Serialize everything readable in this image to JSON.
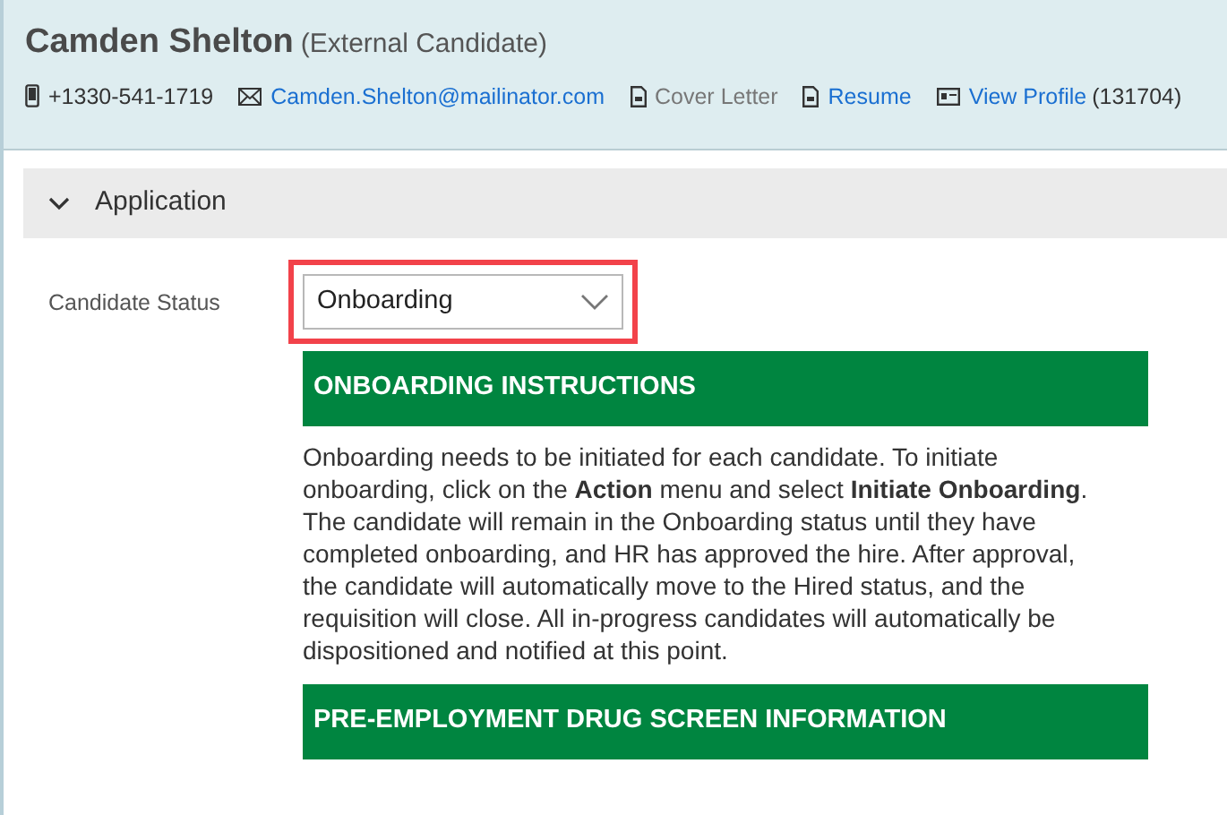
{
  "candidate": {
    "name": "Camden Shelton",
    "type": "(External Candidate)"
  },
  "contacts": [
    {
      "kind": "phone",
      "label": "+1330-541-1719",
      "link": false,
      "disabled": false
    },
    {
      "kind": "email",
      "label": "Camden.Shelton@mailinator.com",
      "link": true,
      "disabled": false
    },
    {
      "kind": "document",
      "label": "Cover Letter",
      "link": false,
      "disabled": true
    },
    {
      "kind": "document",
      "label": "Resume",
      "link": true,
      "disabled": false
    },
    {
      "kind": "profile",
      "label": "View Profile",
      "link": true,
      "disabled": false,
      "suffix": "(131704)"
    }
  ],
  "section": {
    "title": "Application",
    "expanded": true
  },
  "status_field": {
    "label": "Candidate Status",
    "value": "Onboarding",
    "highlighted": true
  },
  "panels": [
    {
      "title": "ONBOARDING INSTRUCTIONS",
      "body": "Onboarding needs to be initiated for each candidate. To initiate onboarding, click on the **Action** menu and select **Initiate Onboarding**. The candidate will remain in the Onboarding status until they have completed onboarding, and HR has approved the hire. After approval, the candidate will automatically move to the Hired status, and the requisition will close. All in-progress candidates will automatically be dispositioned and notified at this point."
    },
    {
      "title": "PRE-EMPLOYMENT DRUG SCREEN INFORMATION"
    }
  ]
}
